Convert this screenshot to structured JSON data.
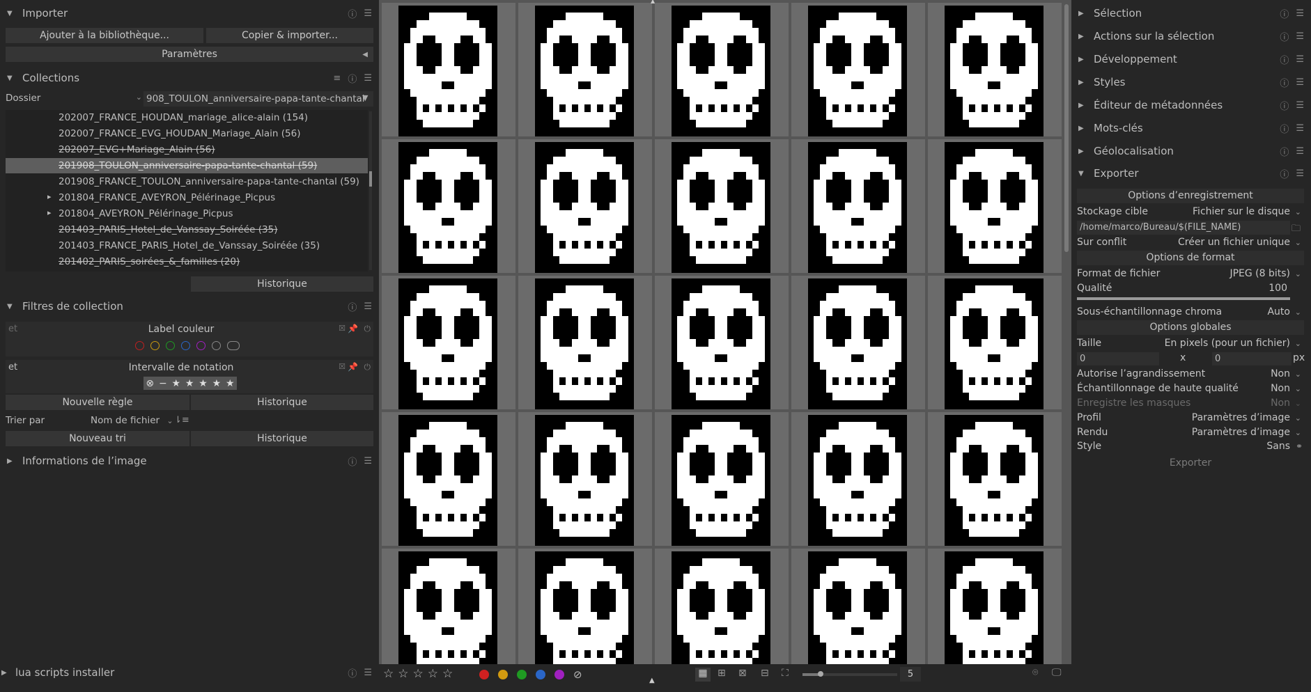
{
  "left": {
    "import": {
      "title": "Importer",
      "add_button": "Ajouter à la bibliothèque...",
      "copy_button": "Copier & importer...",
      "params_button": "Paramètres"
    },
    "collections": {
      "title": "Collections",
      "property": "Dossier",
      "filter_value": "908_TOULON_anniversaire-papa-tante-chantal",
      "items": [
        {
          "label": "202007_FRANCE_HOUDAN_mariage_alice-alain (154)",
          "strike": false,
          "selected": false,
          "expander": false
        },
        {
          "label": "202007_FRANCE_EVG_HOUDAN_Mariage_Alain (56)",
          "strike": false,
          "selected": false,
          "expander": false
        },
        {
          "label": "202007_EVG+Mariage_Alain (56)",
          "strike": true,
          "selected": false,
          "expander": false
        },
        {
          "label": "201908_TOULON_anniversaire-papa-tante-chantal (59)",
          "strike": true,
          "selected": true,
          "expander": false
        },
        {
          "label": "201908_FRANCE_TOULON_anniversaire-papa-tante-chantal (59)",
          "strike": false,
          "selected": false,
          "expander": false
        },
        {
          "label": "201804_FRANCE_AVEYRON_Pélérinage_Picpus",
          "strike": false,
          "selected": false,
          "expander": true
        },
        {
          "label": "201804_AVEYRON_Pélérinage_Picpus",
          "strike": false,
          "selected": false,
          "expander": true
        },
        {
          "label": "201403_PARIS_Hotel_de_Vanssay_Soiréée (35)",
          "strike": true,
          "selected": false,
          "expander": false
        },
        {
          "label": "201403_FRANCE_PARIS_Hotel_de_Vanssay_Soiréée (35)",
          "strike": false,
          "selected": false,
          "expander": false
        },
        {
          "label": "201402_PARIS_soirées_&_familles (20)",
          "strike": true,
          "selected": false,
          "expander": false
        }
      ],
      "history_button": "Historique"
    },
    "filters": {
      "title": "Filtres de collection",
      "rule1_op": "et",
      "rule1_label": "Label couleur",
      "rule2_op": "et",
      "rule2_label": "Intervalle de notation",
      "new_rule_button": "Nouvelle règle",
      "history_button": "Historique",
      "sort_label": "Trier par",
      "sort_value": "Nom de fichier",
      "new_sort_button": "Nouveau tri",
      "history_button2": "Historique"
    },
    "image_info": {
      "title": "Informations de l’image"
    },
    "lua": {
      "title": "lua scripts installer"
    }
  },
  "right": {
    "sections": [
      {
        "title": "Sélection"
      },
      {
        "title": "Actions sur la sélection"
      },
      {
        "title": "Développement"
      },
      {
        "title": "Styles"
      },
      {
        "title": "Éditeur de métadonnées"
      },
      {
        "title": "Mots-clés"
      },
      {
        "title": "Géolocalisation"
      }
    ],
    "export": {
      "title": "Exporter",
      "storage_header": "Options d’enregistrement",
      "target_label": "Stockage cible",
      "target_value": "Fichier sur le disque",
      "path_value": "/home/marco/Bureau/$(FILE_NAME)",
      "conflict_label": "Sur conflit",
      "conflict_value": "Créer un fichier unique",
      "format_header": "Options de format",
      "format_label": "Format de fichier",
      "format_value": "JPEG (8 bits)",
      "quality_label": "Qualité",
      "quality_value": "100",
      "quality_fraction": 1.0,
      "chroma_label": "Sous-échantillonnage chroma",
      "chroma_value": "Auto",
      "global_header": "Options globales",
      "size_label": "Taille",
      "size_value": "En pixels (pour un fichier)",
      "width_value": "0",
      "x_label": "x",
      "height_value": "0",
      "px_label": "px",
      "upscale_label": "Autorise l’agrandissement",
      "upscale_value": "Non",
      "hq_label": "Échantillonnage de haute qualité",
      "hq_value": "Non",
      "masks_label": "Enregistre les masques",
      "masks_value": "Non",
      "profile_label": "Profil",
      "profile_value": "Paramètres d’image",
      "intent_label": "Rendu",
      "intent_value": "Paramètres d’image",
      "style_label": "Style",
      "style_value": "Sans",
      "export_button": "Exporter"
    }
  },
  "bottom": {
    "zoom_value": "5",
    "colors": {
      "red": "#d02020",
      "yellow": "#d29a10",
      "green": "#1f9a22",
      "blue": "#2a66c8",
      "purple": "#a020c0"
    }
  },
  "grid": {
    "columns": 5,
    "rows": 5
  }
}
